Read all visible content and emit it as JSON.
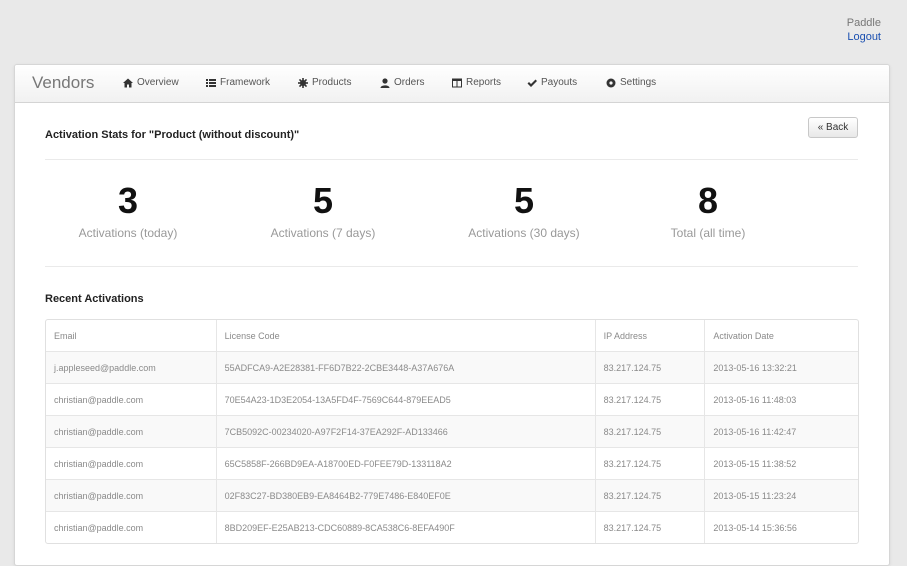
{
  "account": {
    "user": "Paddle",
    "logout": "Logout"
  },
  "nav": {
    "brand": "Vendors",
    "items": [
      {
        "label": "Overview",
        "icon": "home-icon"
      },
      {
        "label": "Framework",
        "icon": "list-icon"
      },
      {
        "label": "Products",
        "icon": "gear-icon"
      },
      {
        "label": "Orders",
        "icon": "user-icon"
      },
      {
        "label": "Reports",
        "icon": "table-icon"
      },
      {
        "label": "Payouts",
        "icon": "check-icon"
      },
      {
        "label": "Settings",
        "icon": "cog-icon"
      }
    ]
  },
  "page": {
    "title": "Activation Stats for \"Product (without discount)\"",
    "back": "« Back"
  },
  "stats": [
    {
      "value": "3",
      "label": "Activations (today)"
    },
    {
      "value": "5",
      "label": "Activations (7 days)"
    },
    {
      "value": "5",
      "label": "Activations (30 days)"
    },
    {
      "value": "8",
      "label": "Total (all time)"
    }
  ],
  "recent": {
    "title": "Recent Activations",
    "columns": [
      "Email",
      "License Code",
      "IP Address",
      "Activation Date"
    ],
    "rows": [
      [
        "j.appleseed@paddle.com",
        "55ADFCA9-A2E28381-FF6D7B22-2CBE3448-A37A676A",
        "83.217.124.75",
        "2013-05-16 13:32:21"
      ],
      [
        "christian@paddle.com",
        "70E54A23-1D3E2054-13A5FD4F-7569C644-879EEAD5",
        "83.217.124.75",
        "2013-05-16 11:48:03"
      ],
      [
        "christian@paddle.com",
        "7CB5092C-00234020-A97F2F14-37EA292F-AD133466",
        "83.217.124.75",
        "2013-05-16 11:42:47"
      ],
      [
        "christian@paddle.com",
        "65C5858F-266BD9EA-A18700ED-F0FEE79D-133118A2",
        "83.217.124.75",
        "2013-05-15 11:38:52"
      ],
      [
        "christian@paddle.com",
        "02F83C27-BD380EB9-EA8464B2-779E7486-E840EF0E",
        "83.217.124.75",
        "2013-05-15 11:23:24"
      ],
      [
        "christian@paddle.com",
        "8BD209EF-E25AB213-CDC60889-8CA538C6-8EFA490F",
        "83.217.124.75",
        "2013-05-14 15:36:56"
      ]
    ]
  }
}
